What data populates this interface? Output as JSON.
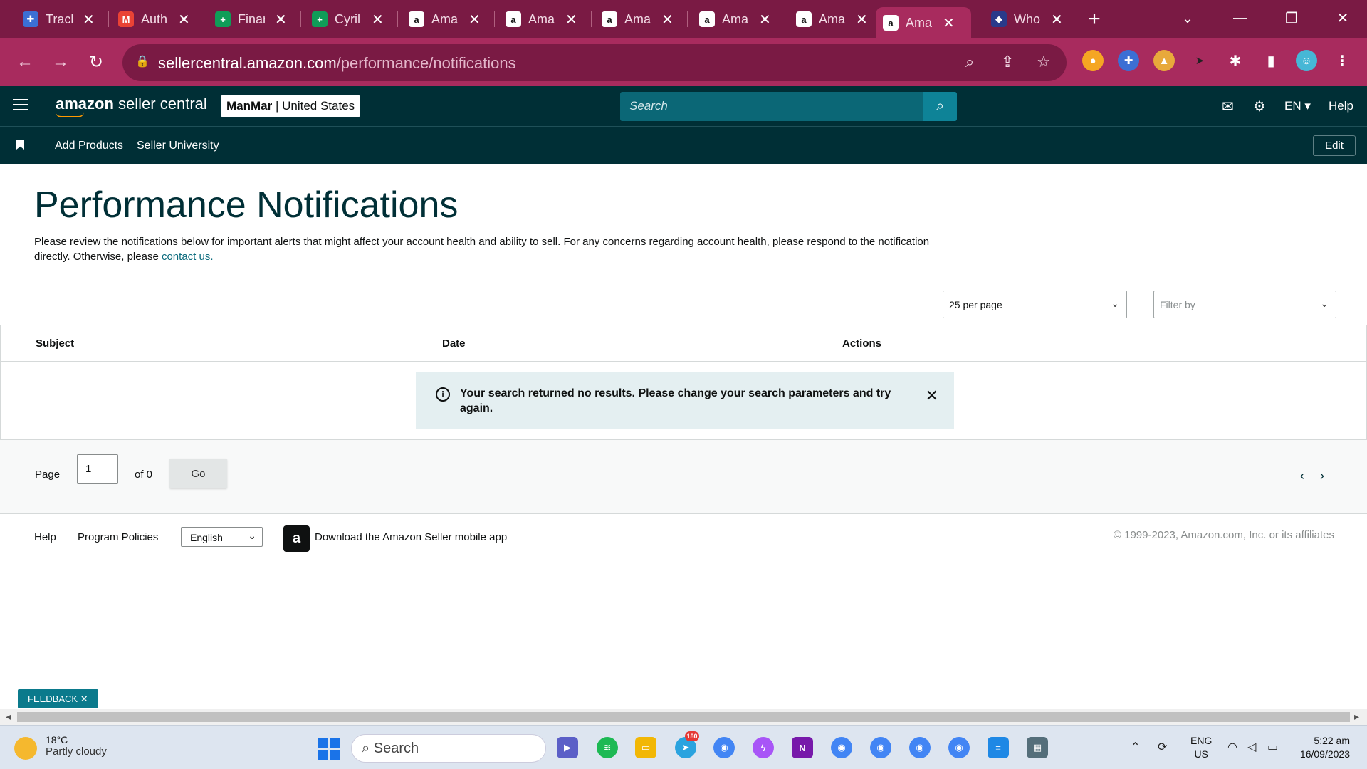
{
  "browser": {
    "tabs": [
      {
        "title": "Track",
        "favicon": "medical-cross-icon",
        "color": "#3b6fd4"
      },
      {
        "title": "Auth",
        "favicon": "gmail-icon",
        "color": "#ea4335"
      },
      {
        "title": "Finan",
        "favicon": "sheets-icon",
        "color": "#0f9d58"
      },
      {
        "title": "Cyril",
        "favicon": "sheets-icon",
        "color": "#0f9d58"
      },
      {
        "title": "Ama",
        "favicon": "amazon-icon",
        "color": "#111111"
      },
      {
        "title": "Ama",
        "favicon": "amazon-icon",
        "color": "#111111"
      },
      {
        "title": "Ama",
        "favicon": "amazon-icon",
        "color": "#111111"
      },
      {
        "title": "Ama",
        "favicon": "amazon-icon",
        "color": "#111111"
      },
      {
        "title": "Ama",
        "favicon": "amazon-icon",
        "color": "#111111"
      },
      {
        "title": "Ama",
        "favicon": "amazon-icon",
        "color": "#111111",
        "active": true
      },
      {
        "title": "Who",
        "favicon": "cube-icon",
        "color": "#2a3a8a"
      }
    ],
    "url_domain": "sellercentral.amazon.com",
    "url_path": "/performance/notifications"
  },
  "header": {
    "logo_brand": "amazon",
    "logo_product": "seller central",
    "account_name": "ManMar",
    "account_region": "United States",
    "search_placeholder": "Search",
    "language": "EN",
    "help": "Help"
  },
  "nav": {
    "links": [
      "Add Products",
      "Seller University"
    ],
    "edit": "Edit"
  },
  "page": {
    "title": "Performance Notifications",
    "description": "Please review the notifications below for important alerts that might affect your account health and ability to sell. For any concerns regarding account health, please respond to the notification directly. Otherwise, please",
    "contact_link": "contact us."
  },
  "controls": {
    "per_page": "25 per page",
    "filter_placeholder": "Filter by"
  },
  "table": {
    "columns": [
      "Subject",
      "Date",
      "Actions"
    ],
    "empty_message": "Your search returned no results. Please change your search parameters and try again."
  },
  "pagination": {
    "page_label": "Page",
    "current_page": "1",
    "of_label": "of 0",
    "go": "Go"
  },
  "footer": {
    "help": "Help",
    "policies": "Program Policies",
    "language": "English",
    "app_text": "Download the Amazon Seller mobile app",
    "copyright": "© 1999-2023, Amazon.com, Inc. or its affiliates"
  },
  "feedback": "FEEDBACK",
  "taskbar": {
    "temperature": "18°C",
    "weather": "Partly cloudy",
    "search": "Search",
    "telegram_badge": "180",
    "lang_top": "ENG",
    "lang_bottom": "US",
    "time": "5:22 am",
    "date": "16/09/2023"
  }
}
